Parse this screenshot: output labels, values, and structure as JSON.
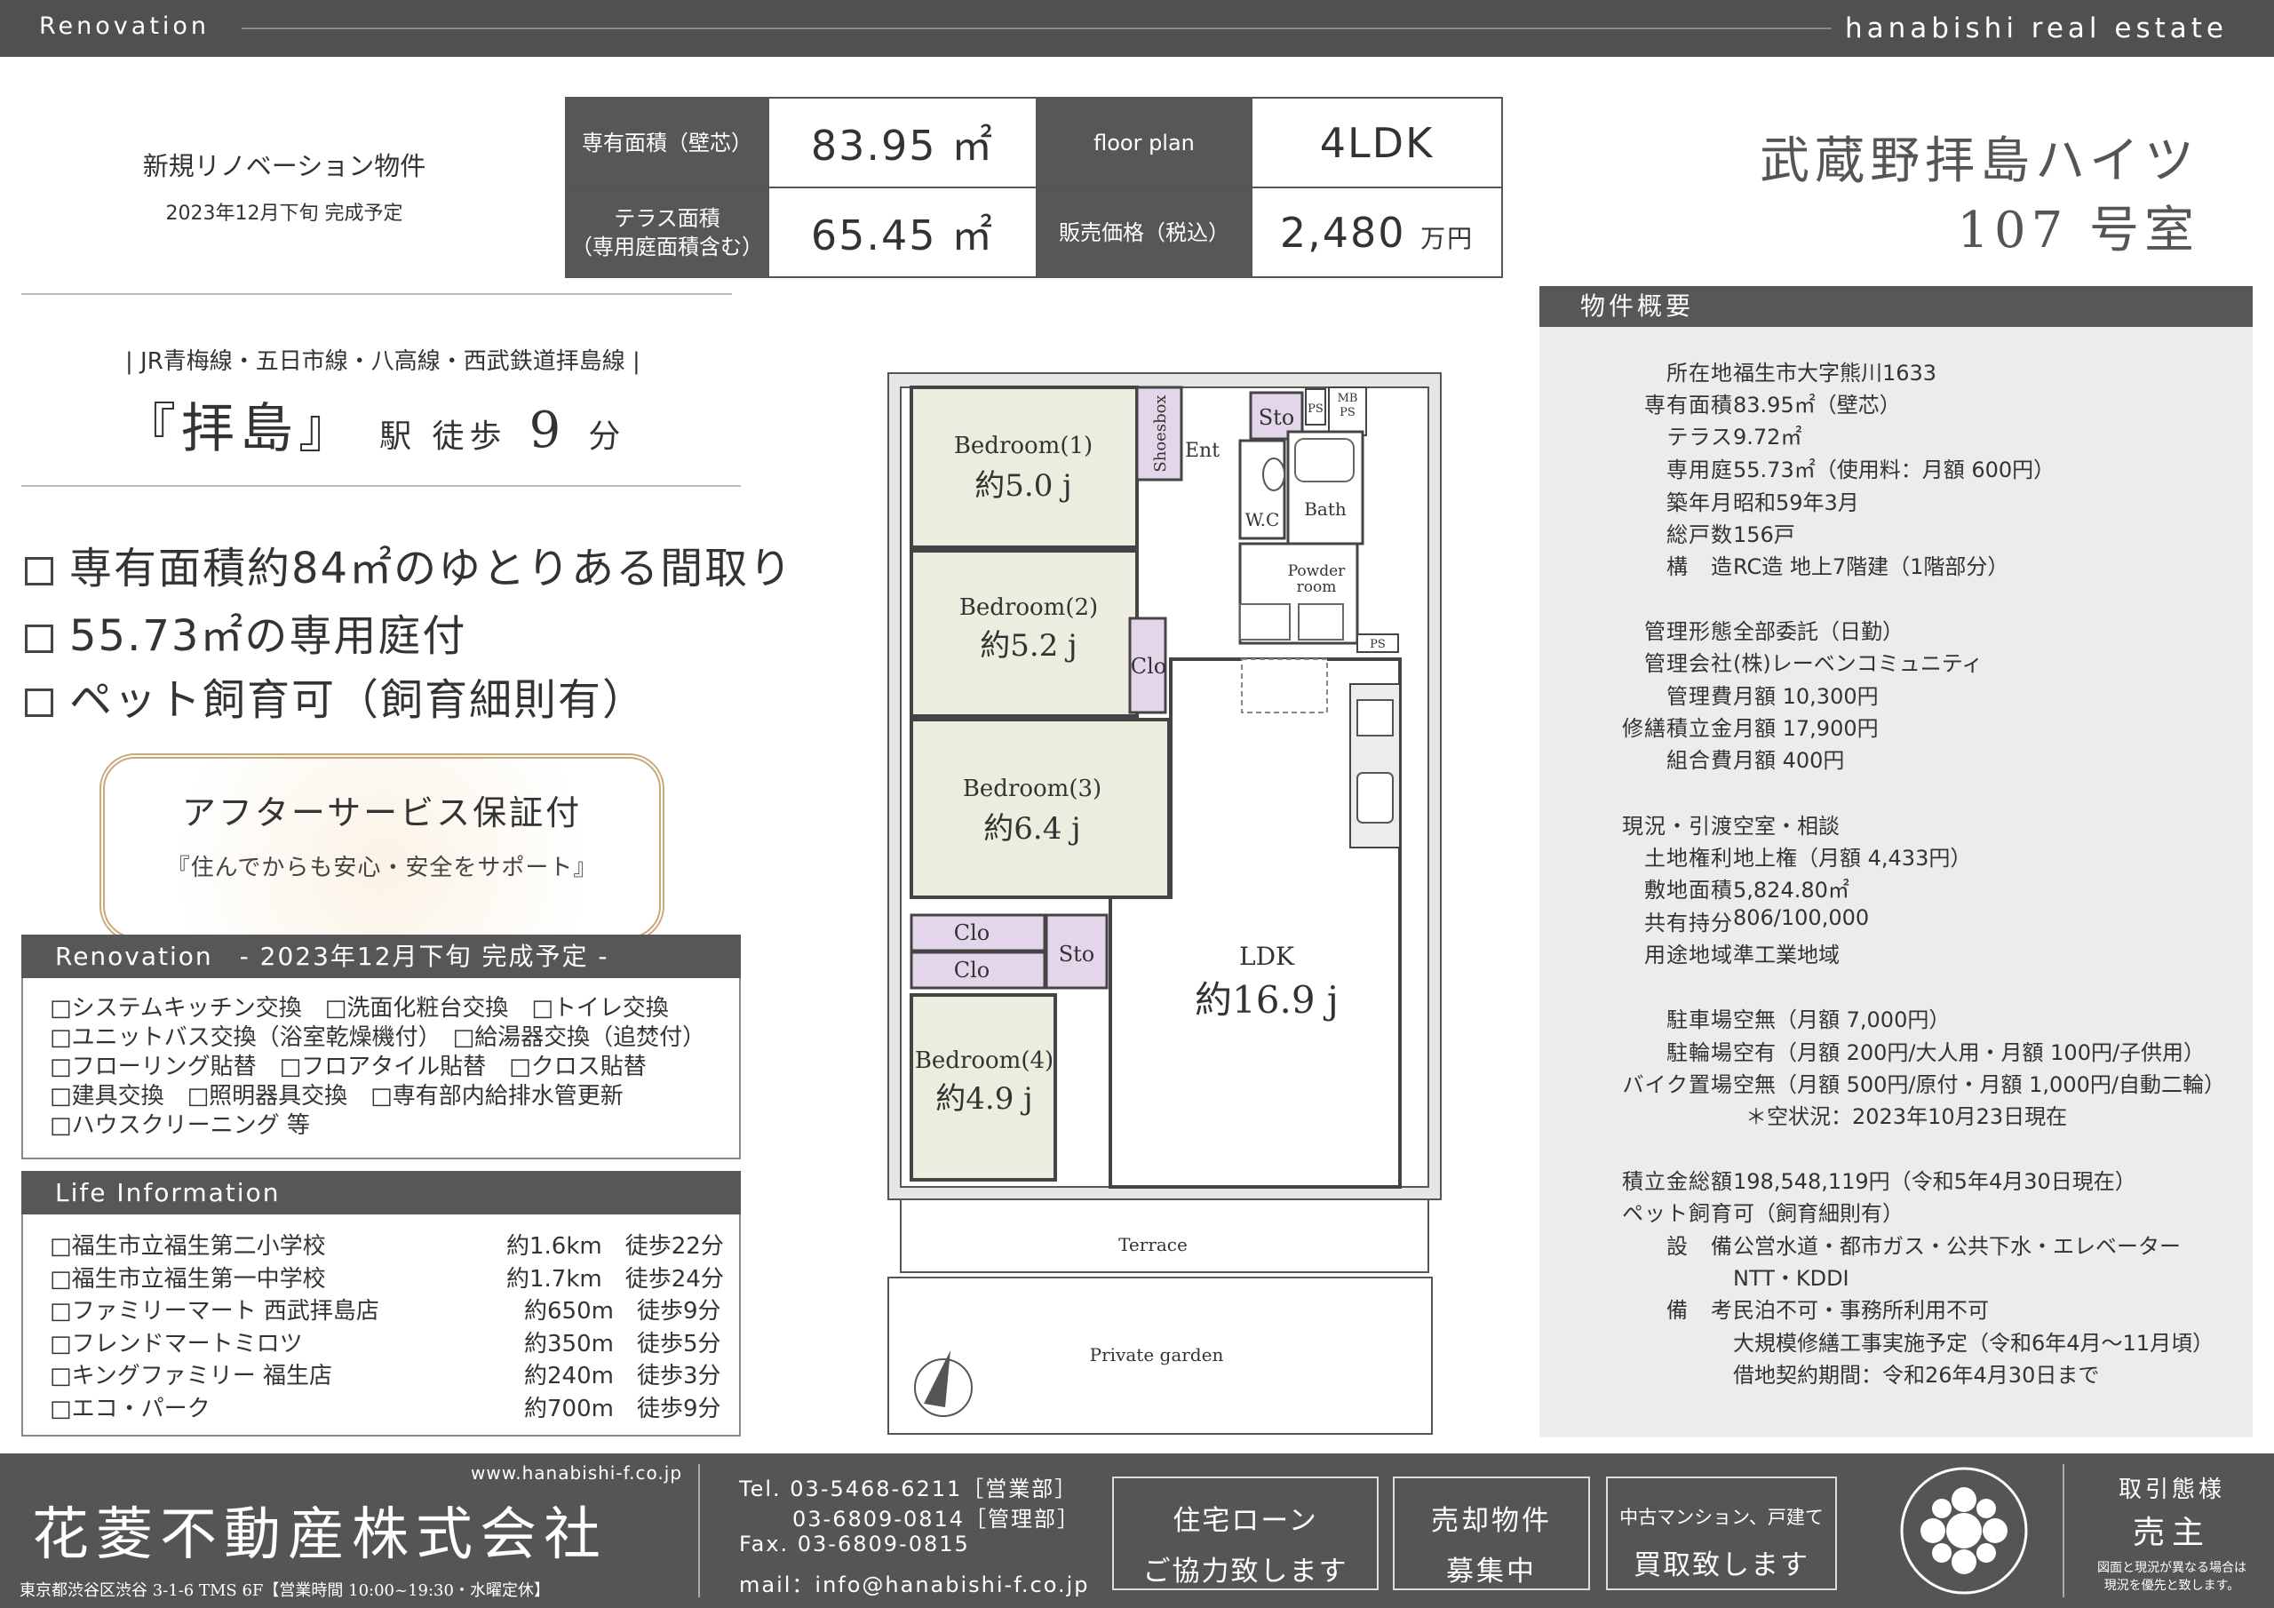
{
  "topbar": {
    "left": "Renovation",
    "right": "hanabishi real estate"
  },
  "header": {
    "tag1": "新規リノベーション物件",
    "tag2": "2023年12月下旬 完成予定",
    "specs": {
      "area_label": "専有面積（壁芯）",
      "area_value": "83.95 ㎡",
      "plan_label": "floor plan",
      "plan_value": "4LDK",
      "terrace_label1": "テラス面積",
      "terrace_label2": "（専用庭面積含む）",
      "terrace_value": "65.45 ㎡",
      "price_label": "販売価格（税込）",
      "price_value": "2,480",
      "price_unit": "万円"
    },
    "building_name": "武蔵野拝島ハイツ",
    "room": "107 号室"
  },
  "station": {
    "lines": "| JR青梅線・五日市線・八高線・西武鉄道拝島線 |",
    "main": "『拝島』",
    "walk": "駅 徒歩",
    "minutes": "9",
    "unit": "分"
  },
  "features": [
    "専有面積約84㎡のゆとりある間取り",
    "55.73㎡の専用庭付",
    "ペット飼育可（飼育細則有）"
  ],
  "cert": {
    "title": "アフターサービス保証付",
    "sub": "『住んでからも安心・安全をサポート』"
  },
  "renovation": {
    "title": "Renovation　- 2023年12月下旬 完成予定 -",
    "lines": [
      "□システムキッチン交換　□洗面化粧台交換　□トイレ交換",
      "□ユニットバス交換（浴室乾燥機付）　□給湯器交換（追焚付）",
      "□フローリング貼替　□フロアタイル貼替　□クロス貼替",
      "□建具交換　□照明器具交換　□専有部内給排水管更新",
      "□ハウスクリーニング 等"
    ]
  },
  "life": {
    "title": "Life Information",
    "items": [
      {
        "name": "□福生市立福生第二小学校",
        "dist": "約1.6km　徒歩22分"
      },
      {
        "name": "□福生市立福生第一中学校",
        "dist": "約1.7km　徒歩24分"
      },
      {
        "name": "□ファミリーマート 西武拝島店",
        "dist": "約650m　徒歩9分"
      },
      {
        "name": "□フレンドマートミロツ",
        "dist": "約350m　徒歩5分"
      },
      {
        "name": "□キングファミリー 福生店",
        "dist": "約240m　徒歩3分"
      },
      {
        "name": "□エコ・パーク",
        "dist": "約700m　徒歩9分"
      }
    ]
  },
  "plan": {
    "rooms": {
      "bed1": "Bedroom(1)",
      "bed1_size": "約5.0 j",
      "bed2": "Bedroom(2)",
      "bed2_size": "約5.2 j",
      "bed3": "Bedroom(3)",
      "bed3_size": "約6.4 j",
      "bed4": "Bedroom(4)",
      "bed4_size": "約4.9 j",
      "ldk": "LDK",
      "ldk_size": "約16.9 j",
      "shoesbox": "Shoesbox",
      "ent": "Ent",
      "sto1": "Sto",
      "sto2": "Sto",
      "ps1": "PS",
      "mbps1": "MB",
      "mbps2": "PS",
      "ps2": "PS",
      "wc": "W.C",
      "bath": "Bath",
      "powder1": "Powder",
      "powder2": "room",
      "clo1": "Clo",
      "clo2": "Clo",
      "clo3": "Clo",
      "terrace": "Terrace",
      "garden": "Private garden"
    }
  },
  "outline": {
    "title": "物件概要",
    "rows": [
      {
        "k": "所在地",
        "v": "福生市大字熊川1633"
      },
      {
        "k": "専有面積",
        "v": "83.95㎡（壁芯）"
      },
      {
        "k": "テラス",
        "v": "9.72㎡"
      },
      {
        "k": "専用庭",
        "v": "55.73㎡（使用料：月額 600円）"
      },
      {
        "k": "築年月",
        "v": "昭和59年3月"
      },
      {
        "k": "総戸数",
        "v": "156戸"
      },
      {
        "k": "構　造",
        "v": "RC造 地上7階建（1階部分）"
      },
      {
        "k": "管理形態",
        "v": "全部委託（日勤）"
      },
      {
        "k": "管理会社",
        "v": "(株)レーベンコミュニティ"
      },
      {
        "k": "管理費",
        "v": "月額 10,300円"
      },
      {
        "k": "修繕積立金",
        "v": "月額 17,900円"
      },
      {
        "k": "組合費",
        "v": "月額 400円"
      },
      {
        "k": "現況・引渡",
        "v": "空室・相談"
      },
      {
        "k": "土地権利",
        "v": "地上権（月額 4,433円）"
      },
      {
        "k": "敷地面積",
        "v": "5,824.80㎡"
      },
      {
        "k": "共有持分",
        "v": "806/100,000"
      },
      {
        "k": "用途地域",
        "v": "準工業地域"
      },
      {
        "k": "駐車場",
        "v": "空無（月額 7,000円）"
      },
      {
        "k": "駐輪場",
        "v": "空有（月額 200円/大人用・月額 100円/子供用）"
      },
      {
        "k": "バイク置場",
        "v": "空無（月額 500円/原付・月額 1,000円/自動二輪）"
      },
      {
        "k": "",
        "v": "＊空状況：2023年10月23日現在"
      },
      {
        "k": "積立金総額",
        "v": "198,548,119円（令和5年4月30日現在）"
      },
      {
        "k": "ペット飼育",
        "v": "可（飼育細則有）"
      },
      {
        "k": "設　備",
        "v": "公営水道・都市ガス・公共下水・エレベーター"
      },
      {
        "k": "",
        "v": "NTT・KDDI"
      },
      {
        "k": "備　考",
        "v": "民泊不可・事務所利用不可"
      },
      {
        "k": "",
        "v": "大規模修繕工事実施予定（令和6年4月～11月頃）"
      },
      {
        "k": "",
        "v": "借地契約期間：令和26年4月30日まで"
      }
    ]
  },
  "footer": {
    "url": "www.hanabishi-f.co.jp",
    "company": "花菱不動産株式会社",
    "address": "東京都渋谷区渋谷 3-1-6 TMS 6F【営業時間 10:00~19:30・水曜定休】",
    "tel1": "Tel. 03-5468-6211［営業部］",
    "tel2": "03-6809-0814［管理部］",
    "fax": "Fax. 03-6809-0815",
    "mail": "mail：info@hanabishi-f.co.jp",
    "box1a": "住宅ローン",
    "box1b": "ご協力致します",
    "box2a": "売却物件",
    "box2b": "募集中",
    "box3a": "中古マンション、戸建て",
    "box3b": "買取致します",
    "deal_label": "取引態様",
    "deal_value": "売主",
    "note1": "図面と現況が異なる場合は",
    "note2": "現況を優先と致します。"
  }
}
